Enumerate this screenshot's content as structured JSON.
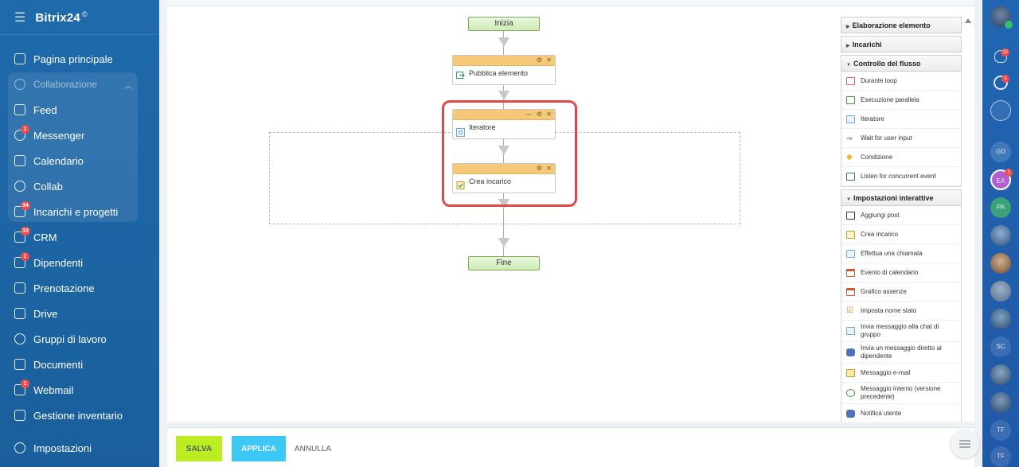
{
  "sidebar": {
    "brand": "Bitrix24",
    "brand_mark": "©",
    "items": [
      {
        "label": "Pagina principale"
      },
      {
        "label": "Collaborazione"
      },
      {
        "label": "Feed"
      },
      {
        "label": "Messenger",
        "badge": "1"
      },
      {
        "label": "Calendario"
      },
      {
        "label": "Collab"
      },
      {
        "label": "Incarichi e progetti",
        "badge": "34"
      },
      {
        "label": "CRM",
        "badge": "33"
      },
      {
        "label": "Dipendenti",
        "badge": "1"
      },
      {
        "label": "Prenotazione"
      },
      {
        "label": "Drive"
      },
      {
        "label": "Gruppi di lavoro"
      },
      {
        "label": "Documenti"
      },
      {
        "label": "Webmail",
        "badge": "1"
      },
      {
        "label": "Gestione inventario"
      }
    ],
    "settings_label": "Impostazioni"
  },
  "workflow": {
    "start_label": "Inizia",
    "end_label": "Fine",
    "activities": [
      {
        "label": "Pubblica elemento"
      },
      {
        "label": "Iteratore"
      },
      {
        "label": "Crea incarico"
      }
    ]
  },
  "panel": {
    "sections": [
      {
        "title": "Elaborazione elemento",
        "expanded": false,
        "items": []
      },
      {
        "title": "Incarichi",
        "expanded": false,
        "items": []
      },
      {
        "title": "Controllo del flusso",
        "expanded": true,
        "items": [
          {
            "label": "Durante loop",
            "icon": "loop-icon",
            "color": "#e35b5b"
          },
          {
            "label": "Esecuzione parallela",
            "icon": "parallel-icon",
            "color": "#3a9a3a"
          },
          {
            "label": "Iteratore",
            "icon": "iterator-icon",
            "color": "#6fa9d6"
          },
          {
            "label": "Wait for user input",
            "icon": "arrow-right-icon",
            "color": "#2fa12f"
          },
          {
            "label": "Condizione",
            "icon": "condition-icon",
            "color": "#f0b429"
          },
          {
            "label": "Listen for concurrent event",
            "icon": "listen-icon",
            "color": "#3b66b8"
          }
        ]
      },
      {
        "title": "Impostazioni interattive",
        "expanded": true,
        "items": [
          {
            "label": "Aggiungi post",
            "icon": "comment-icon",
            "color": "#333333"
          },
          {
            "label": "Crea incarico",
            "icon": "task-icon",
            "color": "#e0b23a"
          },
          {
            "label": "Effettua una chiamata",
            "icon": "call-icon",
            "color": "#6fa9d6"
          },
          {
            "label": "Evento di calendario",
            "icon": "calendar-icon",
            "color": "#d9542c"
          },
          {
            "label": "Grafico assenze",
            "icon": "absence-chart-icon",
            "color": "#d9542c"
          },
          {
            "label": "Imposta nome stato",
            "icon": "checkbox-icon",
            "color": "#e07b26"
          },
          {
            "label": "Invia messaggio alla chat di gruppo",
            "icon": "group-chat-icon",
            "color": "#6fa9d6"
          },
          {
            "label": "Invia un messaggio diretto al dipendente",
            "icon": "direct-message-icon",
            "color": "#4e73b8"
          },
          {
            "label": "Messaggio e-mail",
            "icon": "email-icon",
            "color": "#c7a02a"
          },
          {
            "label": "Messaggio interno (versione precedente)",
            "icon": "internal-message-icon",
            "color": "#3a9a3a"
          },
          {
            "label": "Notifica utente",
            "icon": "notify-icon",
            "color": "#4e73b8"
          }
        ]
      }
    ]
  },
  "bottom": {
    "save_label": "SALVA",
    "apply_label": "APPLICA",
    "cancel_label": "ANNULLA"
  },
  "rightbar": {
    "notifications_badge": "12",
    "pulse_badge": "1",
    "avatars": [
      {
        "initials": "GD"
      },
      {
        "initials": "EA",
        "badge": "1"
      },
      {
        "initials": "PA"
      },
      {
        "initials": ""
      },
      {
        "initials": ""
      },
      {
        "initials": ""
      },
      {
        "initials": ""
      },
      {
        "initials": "SC"
      },
      {
        "initials": ""
      },
      {
        "initials": ""
      },
      {
        "initials": "TF"
      },
      {
        "initials": "TF"
      }
    ]
  }
}
